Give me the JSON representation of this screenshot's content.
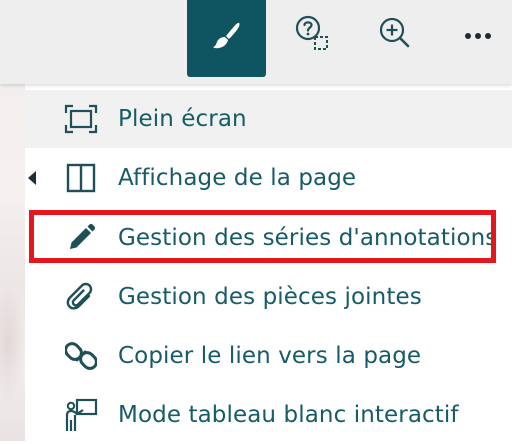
{
  "toolbar": {
    "buttons": [
      {
        "name": "paint-brush",
        "icon": "paint-brush-icon",
        "active": true
      },
      {
        "name": "help-selection",
        "icon": "help-selection-icon"
      },
      {
        "name": "zoom-in",
        "icon": "zoom-in-icon"
      },
      {
        "name": "more-options",
        "icon": "ellipsis-icon"
      }
    ],
    "active_color": "#0e5561"
  },
  "menu": {
    "items": [
      {
        "label": "Plein écran",
        "icon": "fullscreen-icon",
        "state": "hovered"
      },
      {
        "label": "Affichage de la page",
        "icon": "page-layout-icon",
        "has_submenu": true
      },
      {
        "label": "Gestion des séries d'annotations",
        "icon": "pencil-icon",
        "highlighted": true
      },
      {
        "label": "Gestion des pièces jointes",
        "icon": "paperclip-icon"
      },
      {
        "label": "Copier le lien vers la page",
        "icon": "link-icon"
      },
      {
        "label": "Mode tableau blanc interactif",
        "icon": "whiteboard-presenter-icon"
      }
    ],
    "text_color": "#165b67",
    "highlight_color": "#e4171e"
  }
}
